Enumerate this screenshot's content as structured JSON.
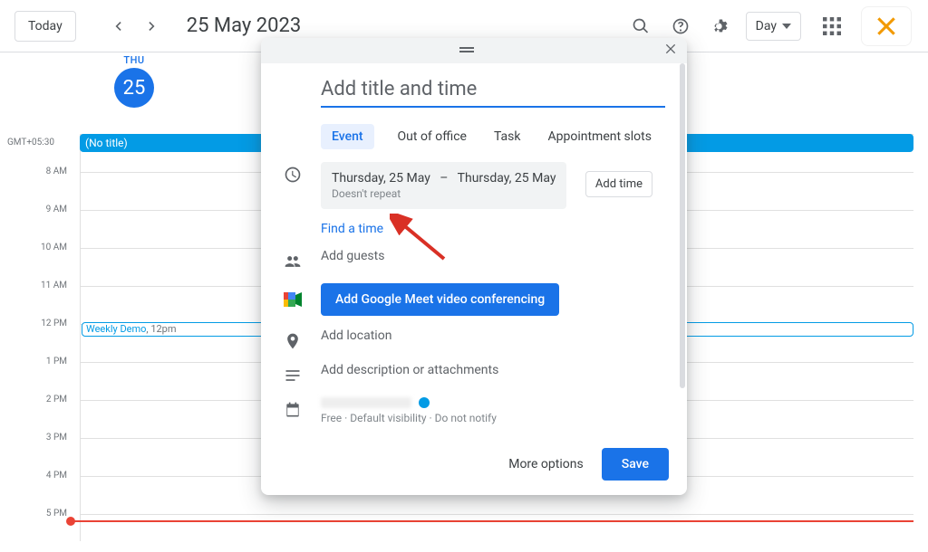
{
  "header": {
    "today_label": "Today",
    "date_label": "25 May 2023",
    "view_label": "Day"
  },
  "day": {
    "dow": "THU",
    "num": "25",
    "tz": "GMT+05:30"
  },
  "hours": [
    "",
    "8 AM",
    "9 AM",
    "10 AM",
    "11 AM",
    "12 PM",
    "1 PM",
    "2 PM",
    "3 PM",
    "4 PM",
    "5 PM"
  ],
  "events": {
    "all_day_title": "(No title)",
    "timed_name": "Weekly Demo",
    "timed_time": ", 12pm"
  },
  "modal": {
    "title_placeholder": "Add title and time",
    "tabs": {
      "event": "Event",
      "ooo": "Out of office",
      "task": "Task",
      "appt": "Appointment slots"
    },
    "start_date": "Thursday, 25 May",
    "end_date": "Thursday, 25 May",
    "dash": "–",
    "repeat": "Doesn't repeat",
    "add_time": "Add time",
    "find_time": "Find a time",
    "add_guests": "Add guests",
    "meet_btn": "Add Google Meet video conferencing",
    "add_location": "Add location",
    "add_desc": "Add description or attachments",
    "cal_meta": "Free  ·  Default visibility  ·  Do not notify",
    "more_options": "More options",
    "save": "Save"
  }
}
